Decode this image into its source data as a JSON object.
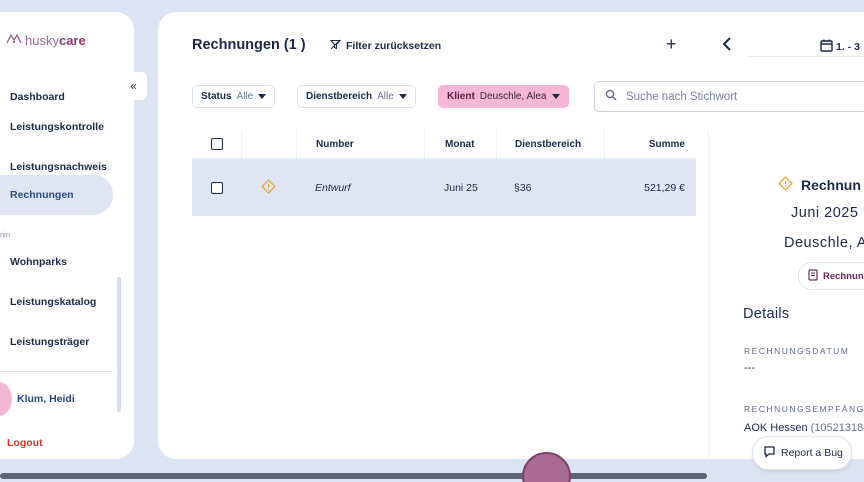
{
  "sidebar": {
    "logo": {
      "part1": "husky",
      "part2": "care"
    },
    "collapse_icon": "«",
    "items": [
      {
        "label": "Dashboard"
      },
      {
        "label": "Leistungskontrolle"
      },
      {
        "label": "Leistungsnachweis"
      },
      {
        "label": "Rechnungen"
      },
      {
        "label": "Wohnparks"
      },
      {
        "label": "Leistungskatalog"
      },
      {
        "label": "Leistungsträger"
      }
    ],
    "section_fragment": "nin",
    "user": {
      "name": "Klum, Heidi"
    },
    "logout": "Logout"
  },
  "header": {
    "title": "Rechnungen (1 )",
    "filter_reset": "Filter zurücksetzen",
    "add_icon": "+",
    "date_range": "1. - 3"
  },
  "filters": [
    {
      "label": "Status",
      "value": "Alle"
    },
    {
      "label": "Dienstbereich",
      "value": "Alle"
    },
    {
      "label": "Klient",
      "value": "Deuschle, Alea"
    }
  ],
  "search": {
    "placeholder": "Suche nach Stichwort",
    "value": ""
  },
  "table": {
    "columns": [
      "Number",
      "Monat",
      "Dienstbereich",
      "Summe"
    ],
    "rows": [
      {
        "status_icon": "warning-icon",
        "number": "Entwurf",
        "monat": "Juni 25",
        "dienstbereich": "§36",
        "summe": "521,29 €"
      }
    ]
  },
  "detail": {
    "title": "Rechnun",
    "month": "Juni 2025",
    "client": "Deuschle, A",
    "button": "Rechnun",
    "section": "Details",
    "fields": [
      {
        "label": "RECHNUNGSDATUM",
        "value": "---",
        "extra": ""
      },
      {
        "label": "RECHNUNGSEMPFÄNGE",
        "value": "AOK Hessen",
        "extra": "(105213188"
      }
    ]
  },
  "report_bug": "Report a Bug",
  "colors": {
    "accent_pink": "#f6b6d8",
    "active_row": "#dfe6f3",
    "warning": "#e8a33a",
    "logout": "#c8392b",
    "brand": "#8a3e6f"
  }
}
